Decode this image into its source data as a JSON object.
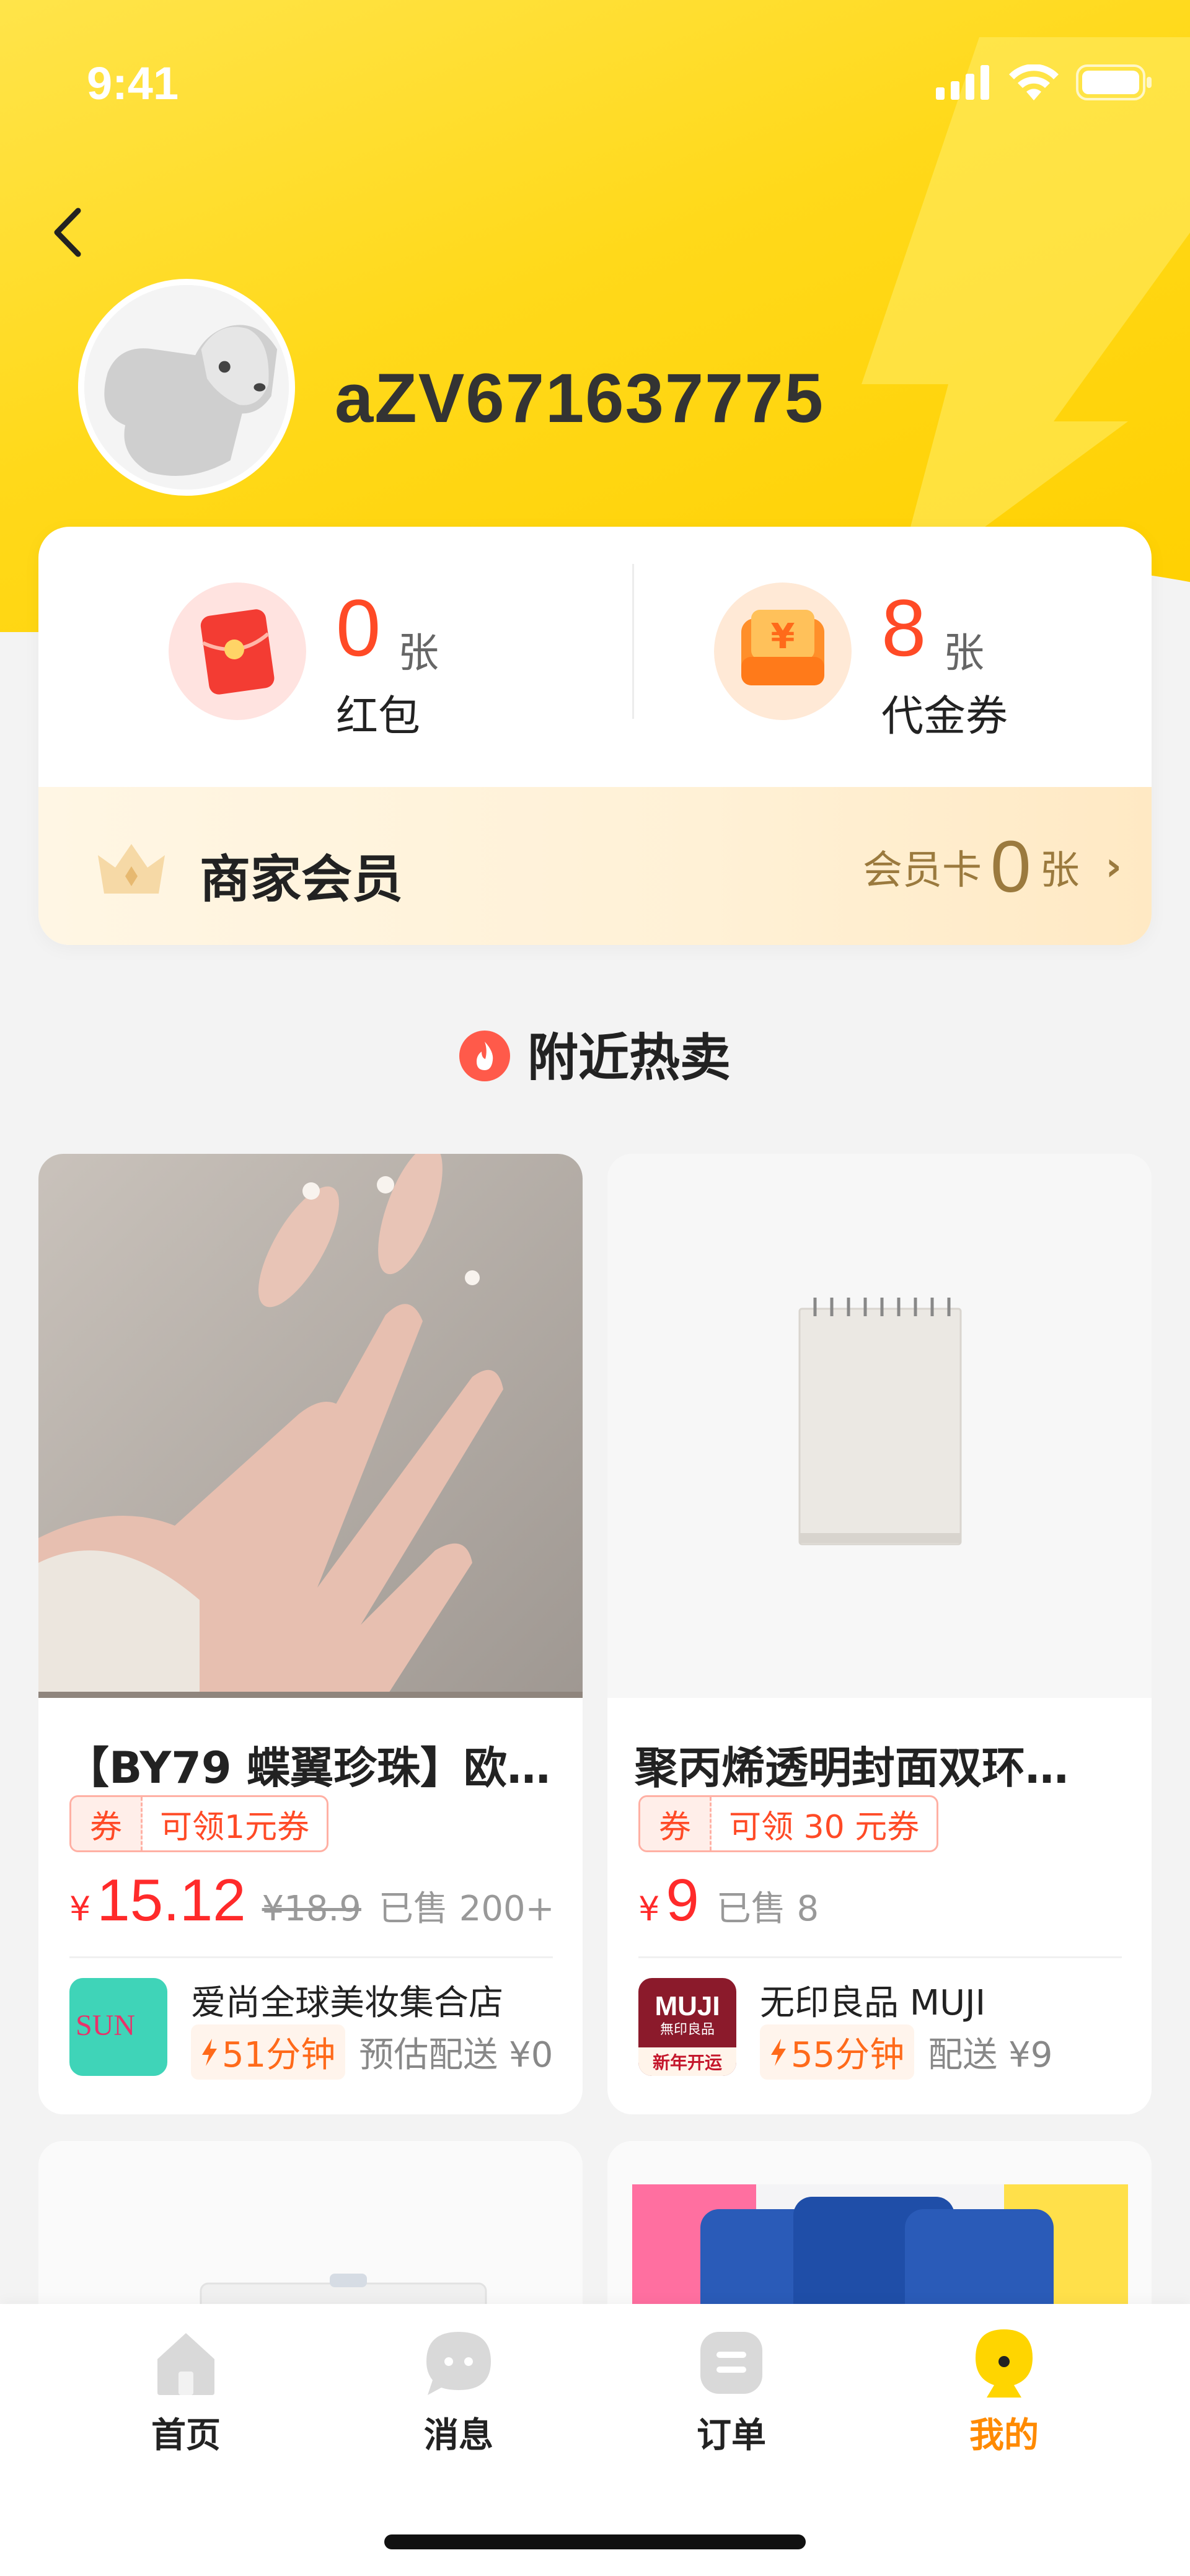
{
  "status": {
    "time": "9:41"
  },
  "profile": {
    "username": "aZV671637775"
  },
  "assets": {
    "red_packet": {
      "count": "0",
      "unit": "张",
      "label": "红包"
    },
    "voucher": {
      "count": "8",
      "unit": "张",
      "label": "代金券"
    }
  },
  "member": {
    "title": "商家会员",
    "card_prefix": "会员卡",
    "card_count": "0",
    "card_unit": "张"
  },
  "section": {
    "title": "附近热卖"
  },
  "products": [
    {
      "title": "【BY79 蝶翼珍珠】欧…",
      "coupon_tag": "券",
      "coupon_text": "可领1元券",
      "currency": "¥",
      "price": "15.12",
      "original_price": "¥18.9",
      "sold": "已售 200+",
      "shop_name": "爱尚全球美妆集合店",
      "delivery_time": "51分钟",
      "delivery_fee": "预估配送 ¥0",
      "shop_logo_text": "SUN"
    },
    {
      "title": "聚丙烯透明封面双环…",
      "coupon_tag": "券",
      "coupon_text": "可领 30 元券",
      "currency": "¥",
      "price": "9",
      "sold": "已售 8",
      "shop_name": "无印良品 MUJI",
      "delivery_time": "55分钟",
      "delivery_fee": "配送 ¥9",
      "shop_logo_text": "MUJI",
      "shop_logo_sub": "無印良品",
      "shop_logo_badge": "新年开运"
    }
  ],
  "tabbar": [
    {
      "label": "首页",
      "icon": "home-icon"
    },
    {
      "label": "消息",
      "icon": "message-icon"
    },
    {
      "label": "订单",
      "icon": "order-icon"
    },
    {
      "label": "我的",
      "icon": "profile-icon",
      "active": true
    }
  ],
  "colors": {
    "accent": "#ffd91a",
    "price": "#ff2a2a",
    "active_tab": "#ff8a00"
  }
}
